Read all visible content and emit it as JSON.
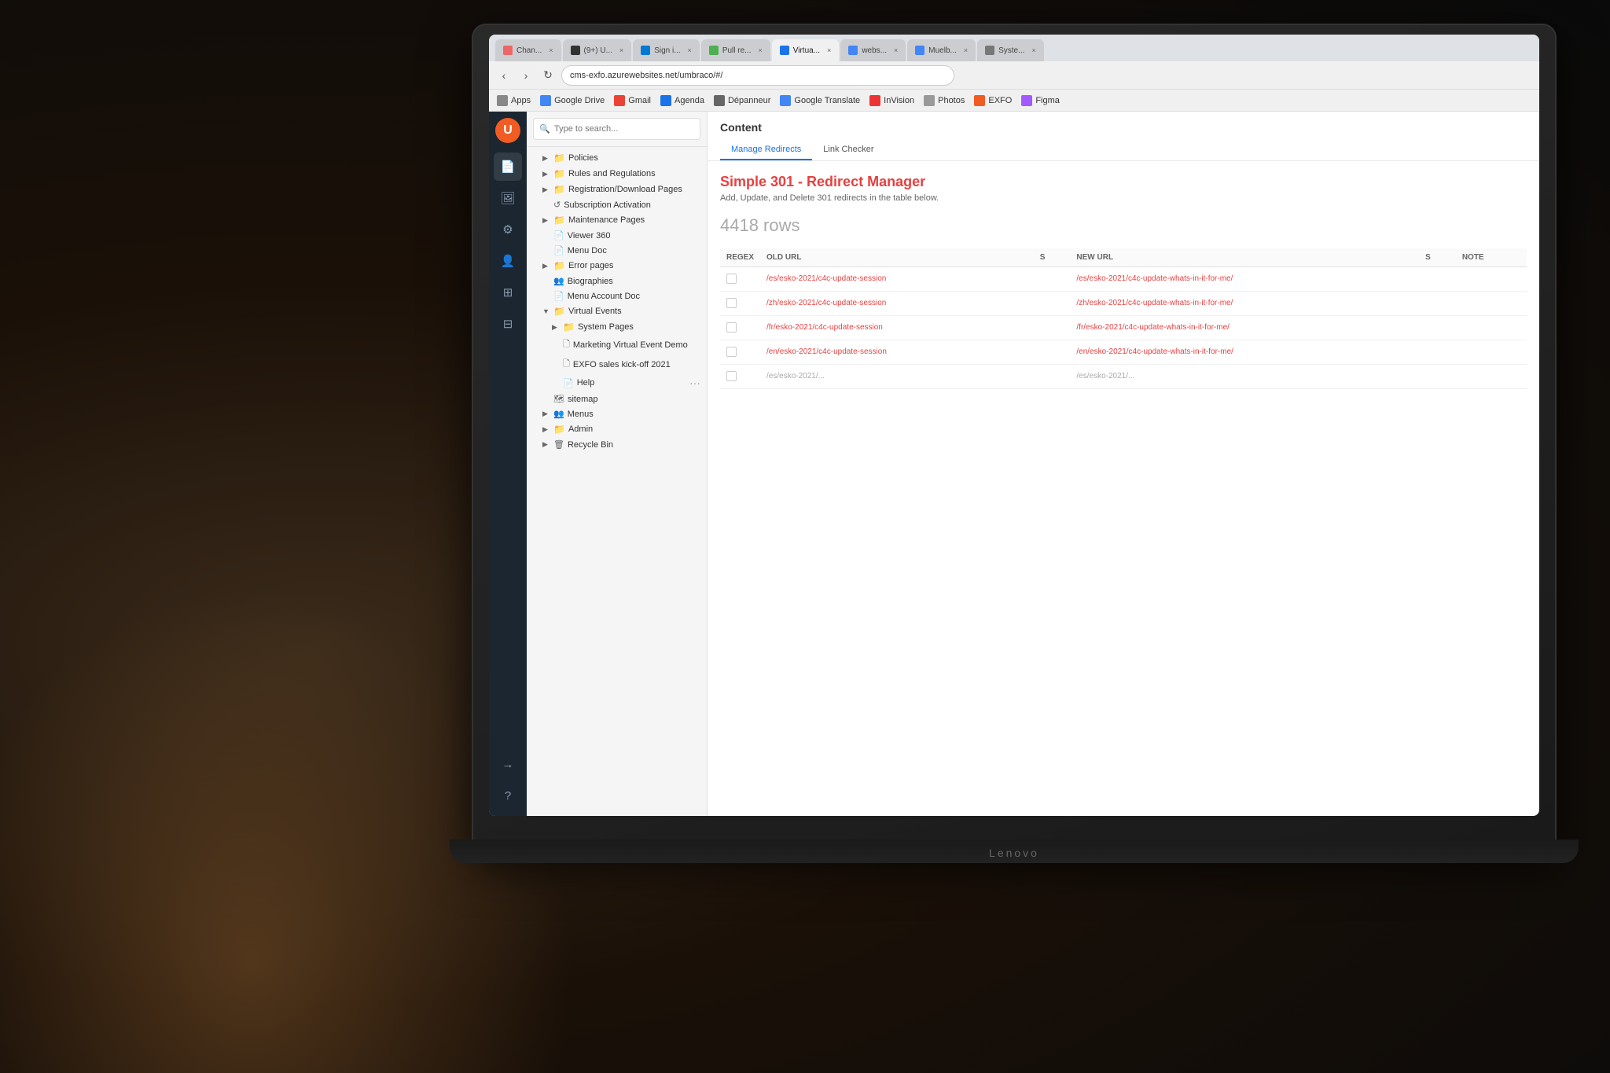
{
  "photo": {
    "bg_description": "Dark office background with person at laptop"
  },
  "browser": {
    "tabs": [
      {
        "id": "tab1",
        "label": "Chan...",
        "active": false,
        "favicon": "C"
      },
      {
        "id": "tab2",
        "label": "(9+) U...",
        "active": false,
        "favicon": "N"
      },
      {
        "id": "tab3",
        "label": "Sign i...",
        "active": false,
        "favicon": "MS"
      },
      {
        "id": "tab4",
        "label": "Pull re...",
        "active": false,
        "favicon": "G"
      },
      {
        "id": "tab5",
        "label": "Virtua...",
        "active": true,
        "favicon": "V"
      },
      {
        "id": "tab6",
        "label": "webs...",
        "active": false,
        "favicon": "G"
      },
      {
        "id": "tab7",
        "label": "Muelb...",
        "active": false,
        "favicon": "G"
      },
      {
        "id": "tab8",
        "label": "Syste...",
        "active": false,
        "favicon": "S"
      }
    ],
    "address": "cms-exfo.azurewebsites.net/umbraco/#/",
    "bookmarks": [
      {
        "label": "Apps",
        "icon": "grid"
      },
      {
        "label": "Google Drive",
        "icon": "drive"
      },
      {
        "label": "Gmail",
        "icon": "mail"
      },
      {
        "label": "Agenda",
        "icon": "calendar"
      },
      {
        "label": "Dépanneur",
        "icon": "tool"
      },
      {
        "label": "Google Translate",
        "icon": "translate"
      },
      {
        "label": "InVision",
        "icon": "inv"
      },
      {
        "label": "Photos",
        "icon": "photo"
      },
      {
        "label": "EXFO",
        "icon": "exfo"
      },
      {
        "label": "Figma",
        "icon": "figma"
      }
    ]
  },
  "umbraco": {
    "icon_bar": [
      {
        "name": "content",
        "icon": "📄",
        "active": true
      },
      {
        "name": "media",
        "icon": "🖼"
      },
      {
        "name": "settings",
        "icon": "⚙"
      },
      {
        "name": "users",
        "icon": "👤"
      },
      {
        "name": "forms",
        "icon": "⊞"
      },
      {
        "name": "deploy",
        "icon": "⊟"
      },
      {
        "name": "redirect",
        "icon": "→"
      },
      {
        "name": "help",
        "icon": "?"
      }
    ]
  },
  "search": {
    "placeholder": "Type to search..."
  },
  "tree": {
    "items": [
      {
        "label": "Policies",
        "type": "folder",
        "indent": 1,
        "expanded": false
      },
      {
        "label": "Rules and Regulations",
        "type": "folder",
        "indent": 1,
        "expanded": false
      },
      {
        "label": "Registration/Download Pages",
        "type": "folder",
        "indent": 1,
        "expanded": false
      },
      {
        "label": "Subscription Activation",
        "type": "file",
        "indent": 1
      },
      {
        "label": "Maintenance Pages",
        "type": "folder",
        "indent": 1,
        "expanded": false
      },
      {
        "label": "Viewer 360",
        "type": "file",
        "indent": 1
      },
      {
        "label": "Menu Doc",
        "type": "file",
        "indent": 1
      },
      {
        "label": "Error pages",
        "type": "folder",
        "indent": 1,
        "expanded": false
      },
      {
        "label": "Biographies",
        "type": "special",
        "indent": 1
      },
      {
        "label": "Menu Account Doc",
        "type": "file",
        "indent": 1
      },
      {
        "label": "Virtual Events",
        "type": "folder",
        "indent": 1,
        "expanded": true
      },
      {
        "label": "System Pages",
        "type": "folder",
        "indent": 2,
        "expanded": false
      },
      {
        "label": "Marketing Virtual Event Demo",
        "type": "page",
        "indent": 2
      },
      {
        "label": "EXFO sales kick-off 2021",
        "type": "page",
        "indent": 2
      },
      {
        "label": "Help",
        "type": "file",
        "indent": 2
      },
      {
        "label": "sitemap",
        "type": "special",
        "indent": 1
      },
      {
        "label": "Menus",
        "type": "folder",
        "indent": 1,
        "expanded": false
      },
      {
        "label": "Admin",
        "type": "folder",
        "indent": 1,
        "expanded": false
      },
      {
        "label": "Recycle Bin",
        "type": "folder",
        "indent": 1,
        "expanded": false
      }
    ]
  },
  "content": {
    "title": "Content",
    "tabs": [
      {
        "label": "Manage Redirects",
        "active": true
      },
      {
        "label": "Link Checker",
        "active": false
      }
    ],
    "redirect_manager": {
      "title": "Simple 301 - Redirect Manager",
      "subtitle": "Add, Update, and Delete 301 redirects in the table below.",
      "rows_count": "4418 rows",
      "table": {
        "columns": [
          "REGEX",
          "OLD URL",
          "S",
          "NEW URL",
          "S",
          "NOTE"
        ],
        "rows": [
          {
            "regex": false,
            "old_url": "/es/esko-2021/c4c-update-session",
            "new_url": "/es/esko-2021/c4c-update-whats-in-it-for-me/"
          },
          {
            "regex": false,
            "old_url": "/zh/esko-2021/c4c-update-session",
            "new_url": "/zh/esko-2021/c4c-update-whats-in-it-for-me/"
          },
          {
            "regex": false,
            "old_url": "/fr/esko-2021/c4c-update-session",
            "new_url": "/fr/esko-2021/c4c-update-whats-in-it-for-me/"
          },
          {
            "regex": false,
            "old_url": "/en/esko-2021/c4c-update-session",
            "new_url": "/en/esko-2021/c4c-update-whats-in-it-for-me/"
          },
          {
            "regex": false,
            "old_url": "/es/esko-2021/...",
            "new_url": "/es/esko-2021/..."
          }
        ]
      }
    }
  },
  "laptop": {
    "brand": "Lenovo"
  }
}
